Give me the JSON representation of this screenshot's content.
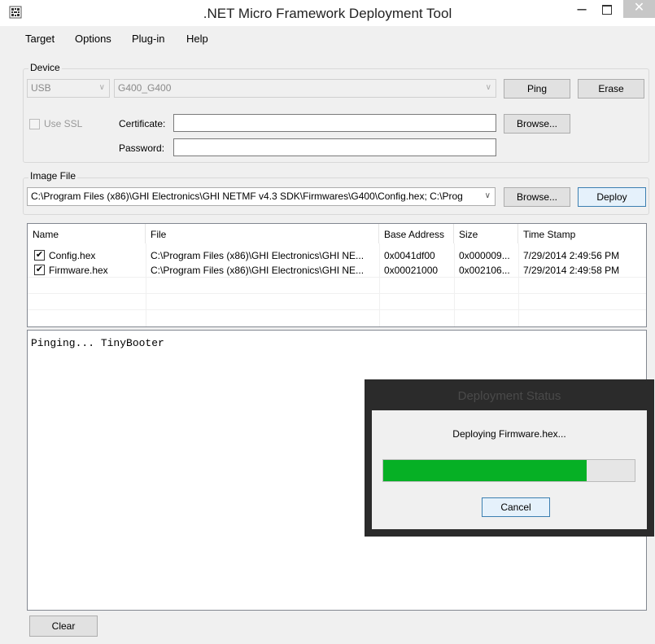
{
  "window": {
    "title": ".NET Micro Framework Deployment Tool",
    "minimize_glyph": "–",
    "close_glyph": "✕"
  },
  "menu": {
    "items": [
      "Target",
      "Options",
      "Plug-in",
      "Help"
    ]
  },
  "device": {
    "group_label": "Device",
    "transport": "USB",
    "device_name": "G400_G400",
    "ping_label": "Ping",
    "erase_label": "Erase",
    "use_ssl_label": "Use SSL",
    "certificate_label": "Certificate:",
    "certificate_value": "",
    "password_label": "Password:",
    "password_value": "",
    "browse_label": "Browse..."
  },
  "image_file": {
    "group_label": "Image File",
    "path": "C:\\Program Files (x86)\\GHI Electronics\\GHI NETMF v4.3 SDK\\Firmwares\\G400\\Config.hex; C:\\Prog",
    "browse_label": "Browse...",
    "deploy_label": "Deploy"
  },
  "file_list": {
    "columns": [
      "Name",
      "File",
      "Base Address",
      "Size",
      "Time Stamp"
    ],
    "rows": [
      {
        "checked": true,
        "name": "Config.hex",
        "file": "C:\\Program Files (x86)\\GHI Electronics\\GHI NE...",
        "base_address": "0x0041df00",
        "size": "0x000009...",
        "time_stamp": "7/29/2014 2:49:56 PM"
      },
      {
        "checked": true,
        "name": "Firmware.hex",
        "file": "C:\\Program Files (x86)\\GHI Electronics\\GHI NE...",
        "base_address": "0x00021000",
        "size": "0x002106...",
        "time_stamp": "7/29/2014 2:49:58 PM"
      }
    ]
  },
  "output": {
    "text": "Pinging... TinyBooter"
  },
  "clear_label": "Clear",
  "deployment_dialog": {
    "title": "Deployment Status",
    "message": "Deploying Firmware.hex...",
    "progress_fraction": 0.81,
    "cancel_label": "Cancel"
  },
  "colors": {
    "progress_fill": "#06b025",
    "dialog_frame": "#2b2b2b"
  },
  "icons": {
    "app": "app-icon",
    "dropdown": "chevron-down-icon",
    "check": "checkmark-icon"
  }
}
